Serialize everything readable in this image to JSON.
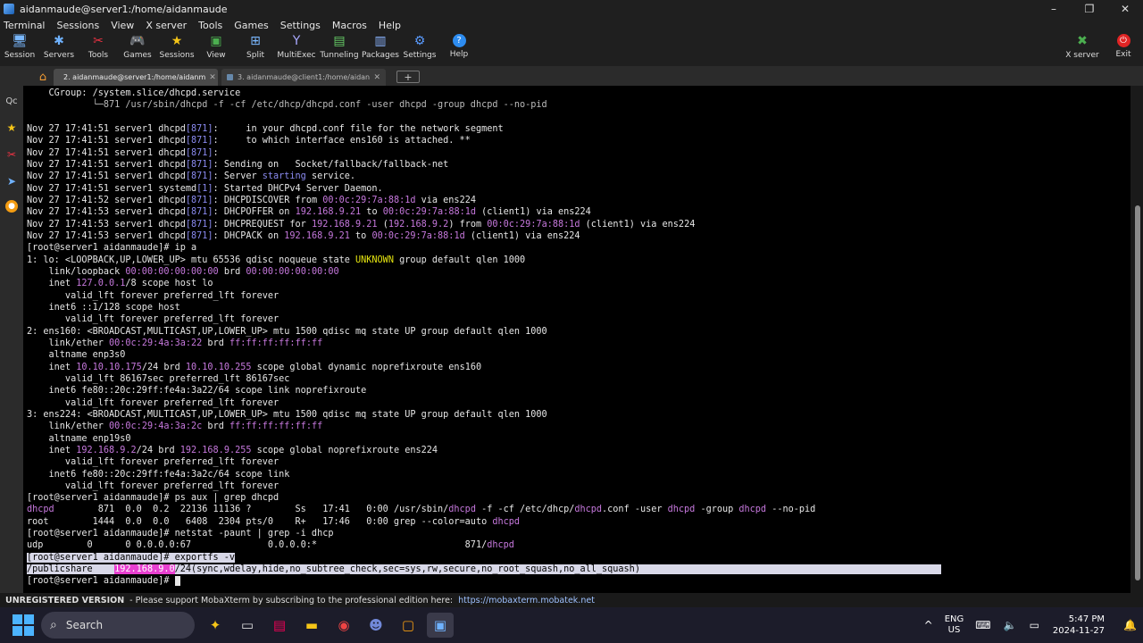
{
  "window": {
    "title": "aidanmaude@server1:/home/aidanmaude",
    "controls": [
      "–",
      "❐",
      "✕"
    ]
  },
  "menu": [
    "Terminal",
    "Sessions",
    "View",
    "X server",
    "Tools",
    "Games",
    "Settings",
    "Macros",
    "Help"
  ],
  "toolbar": {
    "left": [
      {
        "label": "Session",
        "icon": "session-icon"
      },
      {
        "label": "Servers",
        "icon": "servers-icon"
      },
      {
        "label": "Tools",
        "icon": "tools-icon"
      },
      {
        "label": "Games",
        "icon": "games-icon"
      },
      {
        "label": "Sessions",
        "icon": "star-icon"
      },
      {
        "label": "View",
        "icon": "view-icon"
      },
      {
        "label": "Split",
        "icon": "split-icon"
      },
      {
        "label": "MultiExec",
        "icon": "multiexec-icon"
      },
      {
        "label": "Tunneling",
        "icon": "tunneling-icon"
      },
      {
        "label": "Packages",
        "icon": "packages-icon"
      },
      {
        "label": "Settings",
        "icon": "settings-icon"
      },
      {
        "label": "Help",
        "icon": "help-icon"
      }
    ],
    "right": [
      {
        "label": "X server",
        "icon": "xserver-icon"
      },
      {
        "label": "Exit",
        "icon": "exit-icon"
      }
    ]
  },
  "tabs": [
    {
      "label": "2. aidanmaude@server1:/home/aidanm",
      "active": true
    },
    {
      "label": "3. aidanmaude@client1:/home/aidan",
      "active": false
    }
  ],
  "terminal_lines": [
    [
      {
        "t": "    CGroup: /system.slice/dhcpd.service"
      }
    ],
    [
      {
        "t": "            └─871 /usr/sbin/dhcpd -f -cf /etc/dhcp/dhcpd.conf -user dhcpd -group dhcpd --no-pid",
        "c": "dim"
      }
    ],
    [
      {
        "t": ""
      }
    ],
    [
      {
        "t": "Nov 27 17:41:51 server1 dhcpd"
      },
      {
        "t": "[871]",
        "c": "g"
      },
      {
        "t": ":     in your dhcpd.conf file for the network segment"
      }
    ],
    [
      {
        "t": "Nov 27 17:41:51 server1 dhcpd"
      },
      {
        "t": "[871]",
        "c": "g"
      },
      {
        "t": ":     to which interface ens160 is attached. **"
      }
    ],
    [
      {
        "t": "Nov 27 17:41:51 server1 dhcpd"
      },
      {
        "t": "[871]",
        "c": "g"
      },
      {
        "t": ":"
      }
    ],
    [
      {
        "t": "Nov 27 17:41:51 server1 dhcpd"
      },
      {
        "t": "[871]",
        "c": "g"
      },
      {
        "t": ": Sending on   Socket/fallback/fallback-net"
      }
    ],
    [
      {
        "t": "Nov 27 17:41:51 server1 dhcpd"
      },
      {
        "t": "[871]",
        "c": "g"
      },
      {
        "t": ": Server "
      },
      {
        "t": "starting",
        "c": "g"
      },
      {
        "t": " service."
      }
    ],
    [
      {
        "t": "Nov 27 17:41:51 server1 systemd"
      },
      {
        "t": "[1]",
        "c": "g"
      },
      {
        "t": ": Started DHCPv4 Server Daemon."
      }
    ],
    [
      {
        "t": "Nov 27 17:41:52 server1 dhcpd"
      },
      {
        "t": "[871]",
        "c": "g"
      },
      {
        "t": ": DHCPDISCOVER from "
      },
      {
        "t": "00:0c:29:7a:88:1d",
        "c": "p"
      },
      {
        "t": " via ens224"
      }
    ],
    [
      {
        "t": "Nov 27 17:41:53 server1 dhcpd"
      },
      {
        "t": "[871]",
        "c": "g"
      },
      {
        "t": ": DHCPOFFER on "
      },
      {
        "t": "192.168.9.21",
        "c": "p"
      },
      {
        "t": " to "
      },
      {
        "t": "00:0c:29:7a:88:1d",
        "c": "p"
      },
      {
        "t": " (client1) via ens224"
      }
    ],
    [
      {
        "t": "Nov 27 17:41:53 server1 dhcpd"
      },
      {
        "t": "[871]",
        "c": "g"
      },
      {
        "t": ": DHCPREQUEST for "
      },
      {
        "t": "192.168.9.21",
        "c": "p"
      },
      {
        "t": " ("
      },
      {
        "t": "192.168.9.2",
        "c": "p"
      },
      {
        "t": ") from "
      },
      {
        "t": "00:0c:29:7a:88:1d",
        "c": "p"
      },
      {
        "t": " (client1) via ens224"
      }
    ],
    [
      {
        "t": "Nov 27 17:41:53 server1 dhcpd"
      },
      {
        "t": "[871]",
        "c": "g"
      },
      {
        "t": ": DHCPACK on "
      },
      {
        "t": "192.168.9.21",
        "c": "p"
      },
      {
        "t": " to "
      },
      {
        "t": "00:0c:29:7a:88:1d",
        "c": "p"
      },
      {
        "t": " (client1) via ens224"
      }
    ],
    [
      {
        "t": "[root@server1 aidanmaude]# ip a"
      }
    ],
    [
      {
        "t": "1: lo: <LOOPBACK,UP,LOWER_UP> mtu 65536 qdisc noqueue state "
      },
      {
        "t": "UNKNOWN",
        "c": "y"
      },
      {
        "t": " group default qlen 1000"
      }
    ],
    [
      {
        "t": "    link/loopback "
      },
      {
        "t": "00:00:00:00:00:00",
        "c": "p"
      },
      {
        "t": " brd "
      },
      {
        "t": "00:00:00:00:00:00",
        "c": "p"
      }
    ],
    [
      {
        "t": "    inet "
      },
      {
        "t": "127.0.0.1",
        "c": "p"
      },
      {
        "t": "/8 scope host lo"
      }
    ],
    [
      {
        "t": "       valid_lft forever preferred_lft forever"
      }
    ],
    [
      {
        "t": "    inet6 ::1/128 scope host"
      }
    ],
    [
      {
        "t": "       valid_lft forever preferred_lft forever"
      }
    ],
    [
      {
        "t": "2: ens160: <BROADCAST,MULTICAST,UP,LOWER_UP> mtu 1500 qdisc mq state UP group default qlen 1000"
      }
    ],
    [
      {
        "t": "    link/ether "
      },
      {
        "t": "00:0c:29:4a:3a:22",
        "c": "p"
      },
      {
        "t": " brd "
      },
      {
        "t": "ff:ff:ff:ff:ff:ff",
        "c": "p"
      }
    ],
    [
      {
        "t": "    altname enp3s0"
      }
    ],
    [
      {
        "t": "    inet "
      },
      {
        "t": "10.10.10.175",
        "c": "p"
      },
      {
        "t": "/24 brd "
      },
      {
        "t": "10.10.10.255",
        "c": "p"
      },
      {
        "t": " scope global dynamic noprefixroute ens160"
      }
    ],
    [
      {
        "t": "       valid_lft 86167sec preferred_lft 86167sec"
      }
    ],
    [
      {
        "t": "    inet6 fe80::20c:29ff:fe4a:3a22/64 scope link noprefixroute"
      }
    ],
    [
      {
        "t": "       valid_lft forever preferred_lft forever"
      }
    ],
    [
      {
        "t": "3: ens224: <BROADCAST,MULTICAST,UP,LOWER_UP> mtu 1500 qdisc mq state UP group default qlen 1000"
      }
    ],
    [
      {
        "t": "    link/ether "
      },
      {
        "t": "00:0c:29:4a:3a:2c",
        "c": "p"
      },
      {
        "t": " brd "
      },
      {
        "t": "ff:ff:ff:ff:ff:ff",
        "c": "p"
      }
    ],
    [
      {
        "t": "    altname enp19s0"
      }
    ],
    [
      {
        "t": "    inet "
      },
      {
        "t": "192.168.9.2",
        "c": "p"
      },
      {
        "t": "/24 brd "
      },
      {
        "t": "192.168.9.255",
        "c": "p"
      },
      {
        "t": " scope global noprefixroute ens224"
      }
    ],
    [
      {
        "t": "       valid_lft forever preferred_lft forever"
      }
    ],
    [
      {
        "t": "    inet6 fe80::20c:29ff:fe4a:3a2c/64 scope link"
      }
    ],
    [
      {
        "t": "       valid_lft forever preferred_lft forever"
      }
    ],
    [
      {
        "t": "[root@server1 aidanmaude]# ps aux | grep dhcpd"
      }
    ],
    [
      {
        "t": "dhcpd",
        "c": "c"
      },
      {
        "t": "        871  0.0  0.2  22136 11136 ?        Ss   17:41   0:00 /usr/sbin/"
      },
      {
        "t": "dhcpd",
        "c": "c"
      },
      {
        "t": " -f -cf /etc/dhcp/"
      },
      {
        "t": "dhcpd",
        "c": "c"
      },
      {
        "t": ".conf -user "
      },
      {
        "t": "dhcpd",
        "c": "c"
      },
      {
        "t": " -group "
      },
      {
        "t": "dhcpd",
        "c": "c"
      },
      {
        "t": " --no-pid"
      }
    ],
    [
      {
        "t": "root        1444  0.0  0.0   6408  2304 pts/0    R+   17:46   0:00 grep --color=auto "
      },
      {
        "t": "dhcpd",
        "c": "c"
      }
    ],
    [
      {
        "t": "[root@server1 aidanmaude]# netstat -paunt | grep -i dhcp"
      }
    ],
    [
      {
        "t": "udp        0      0 0.0.0.0:67              0.0.0.0:*                           871/"
      },
      {
        "t": "dhcpd",
        "c": "c"
      }
    ],
    [
      {
        "t": "[root@server1 aidanmaude]# exportfs -v",
        "c": "hl"
      }
    ],
    [
      {
        "t": "/publicshare    ",
        "c": "hl"
      },
      {
        "t": "192.168.9.0",
        "c": "hlm"
      },
      {
        "t": "/24(sync,wdelay,hide,no_subtree_check,sec=sys,rw,secure,no_root_squash,no_all_squash)                                                       ",
        "c": "hl"
      }
    ],
    [
      {
        "t": "[root@server1 aidanmaude]# "
      },
      {
        "t": " ",
        "c": "cursor"
      }
    ]
  ],
  "status": {
    "unregistered": "UNREGISTERED VERSION",
    "message": "-  Please support MobaXterm by subscribing to the professional edition here:",
    "link": "https://mobaxterm.mobatek.net"
  },
  "taskbar": {
    "search_placeholder": "Search",
    "language": [
      "ENG",
      "US"
    ],
    "time": "5:47 PM",
    "date": "2024-11-27"
  },
  "colors": {
    "prompt_purple": "#c678dd",
    "bracket_blue": "#8a8af0",
    "highlight_bg": "#d8d8e8",
    "highlight_magenta": "#e83fd0"
  }
}
